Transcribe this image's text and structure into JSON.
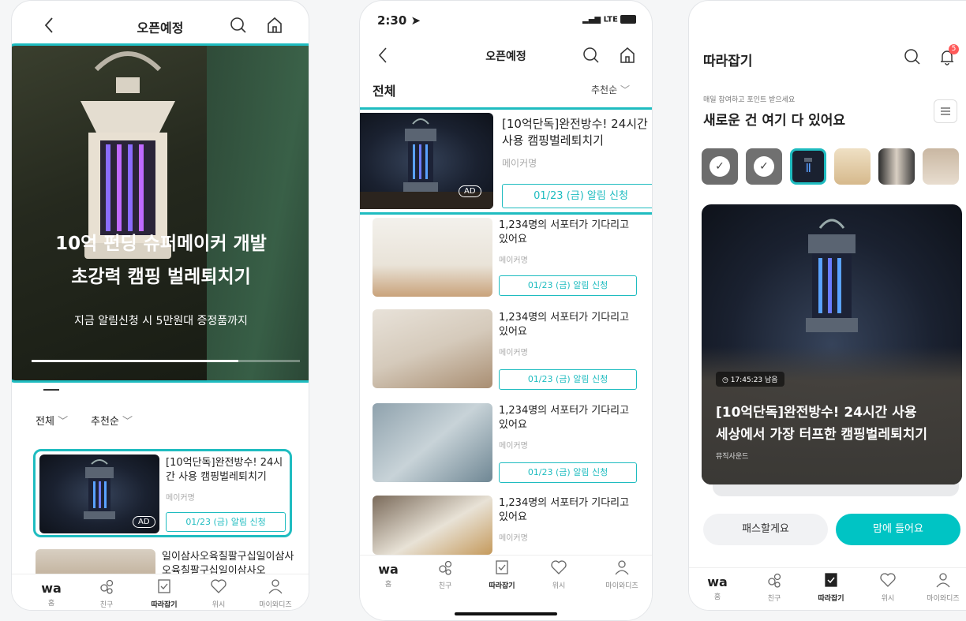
{
  "phone1": {
    "header_title": "오픈예정",
    "hero": {
      "title_line1": "10억 펀딩 슈퍼메이커 개발",
      "title_line2": "초강력 캠핑 벌레퇴치기",
      "subtitle": "지금 알림신청 시 5만원대 증정품까지",
      "progress": 0.77
    },
    "filters": {
      "category": "전체",
      "sort": "추천순"
    },
    "featured": {
      "title": "[10억단독]완전방수! 24시간 사용 캠핑벌레퇴치기",
      "maker": "메이커명",
      "ad": "AD",
      "button": "01/23 (금) 알림 신청"
    },
    "next_item_title": "일이삼사오육칠팔구십일이삼사오육칠팔구십일이삼사오",
    "tabs": [
      "홈",
      "친구",
      "따라잡기",
      "위시",
      "마이와디즈"
    ],
    "active_tab": 2
  },
  "phone2": {
    "status_time": "2:30",
    "status_net": "LTE",
    "header_title": "오픈예정",
    "section_title": "전체",
    "sort": "추천순",
    "featured": {
      "title": "[10억단독]완전방수! 24시간 사용 캠핑벌레퇴치기",
      "maker": "메이커명",
      "ad": "AD",
      "button": "01/23 (금) 알림 신청"
    },
    "items": [
      {
        "title": "1,234명의 서포터가 기다리고 있어요",
        "maker": "메이커명",
        "button": "01/23 (금) 알림 신청"
      },
      {
        "title": "1,234명의 서포터가 기다리고 있어요",
        "maker": "메이커명",
        "button": "01/23 (금) 알림 신청"
      },
      {
        "title": "1,234명의 서포터가 기다리고 있어요",
        "maker": "메이커명",
        "button": "01/23 (금) 알림 신청"
      },
      {
        "title": "1,234명의 서포터가 기다리고 있어요",
        "maker": "메이커명",
        "button": ""
      }
    ],
    "tabs": [
      "홈",
      "친구",
      "따라잡기",
      "위시",
      "마이와디즈"
    ],
    "active_tab": 2
  },
  "phone3": {
    "header_title": "따라잡기",
    "bell_badge": "5",
    "small_caption": "매일 참여하고 포인트 받으세요",
    "headline": "새로운 건 여기 다 있어요",
    "card": {
      "timer": "17:45:23 남음",
      "title_line1": "[10억단독]완전방수! 24시간 사용",
      "title_line2": "세상에서 가장 터프한 캠핑벌레퇴치기",
      "maker": "뮤직사운드"
    },
    "pass_button": "패스할게요",
    "like_button": "맘에 들어요",
    "tabs": [
      "홈",
      "친구",
      "따라잡기",
      "위시",
      "마이와디즈"
    ],
    "active_tab": 2
  },
  "colors": {
    "accent": "#1fbcc0",
    "accent_fill": "#00c4c4",
    "badge": "#ff5a5a"
  },
  "logo": "wa"
}
